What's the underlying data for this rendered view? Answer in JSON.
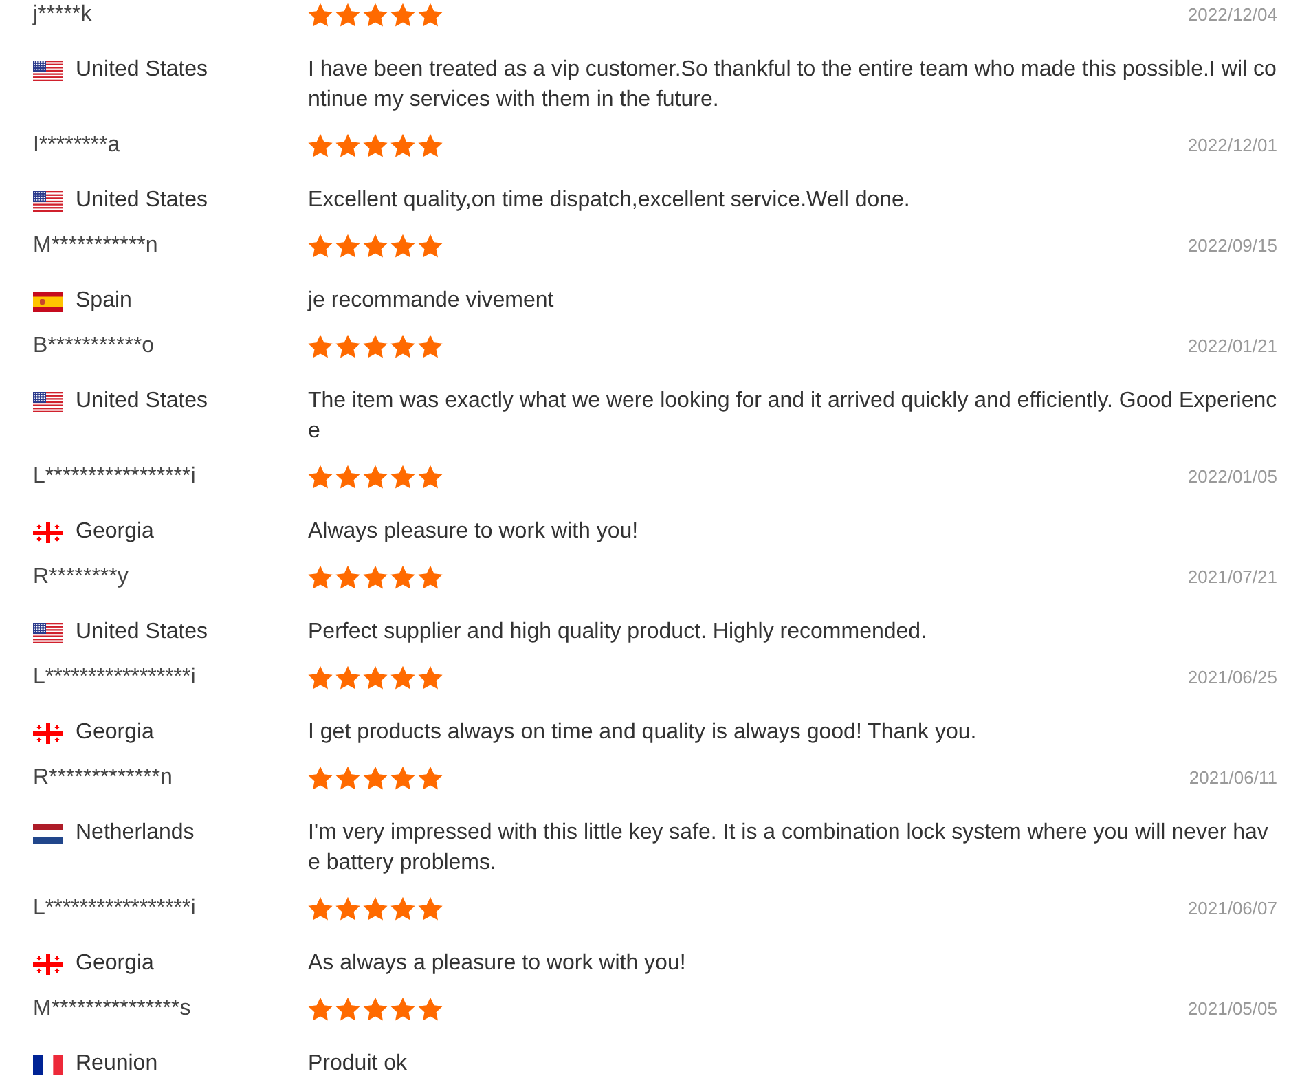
{
  "reviews": [
    {
      "name": "j*****k",
      "stars": 5,
      "date": "2022/12/04",
      "flag": {
        "kind": "us"
      },
      "country": "United States",
      "comment": "I have been treated as a vip customer.So thankful to the entire team who made this possible.I wil continue my services with them in the future."
    },
    {
      "name": "I********a",
      "stars": 5,
      "date": "2022/12/01",
      "flag": {
        "kind": "us"
      },
      "country": "United States",
      "comment": "Excellent quality,on time dispatch,excellent service.Well done."
    },
    {
      "name": "M***********n",
      "stars": 5,
      "date": "2022/09/15",
      "flag": {
        "kind": "es"
      },
      "country": "Spain",
      "comment": "je recommande vivement"
    },
    {
      "name": "B***********o",
      "stars": 5,
      "date": "2022/01/21",
      "flag": {
        "kind": "us"
      },
      "country": "United States",
      "comment": "The item was exactly what we were looking for and it arrived quickly and efficiently. Good Experience"
    },
    {
      "name": "L*****************i",
      "stars": 5,
      "date": "2022/01/05",
      "flag": {
        "kind": "ge"
      },
      "country": "Georgia",
      "comment": "Always pleasure to work with you!"
    },
    {
      "name": "R********y",
      "stars": 5,
      "date": "2021/07/21",
      "flag": {
        "kind": "us"
      },
      "country": "United States",
      "comment": "Perfect supplier and high quality product. Highly recommended."
    },
    {
      "name": "L*****************i",
      "stars": 5,
      "date": "2021/06/25",
      "flag": {
        "kind": "ge"
      },
      "country": "Georgia",
      "comment": "I get products always on time and quality is always good! Thank you."
    },
    {
      "name": "R*************n",
      "stars": 5,
      "date": "2021/06/11",
      "flag": {
        "kind": "nl"
      },
      "country": "Netherlands",
      "comment": "I'm very impressed with this little key safe. It is a combination lock system where you will never have battery problems."
    },
    {
      "name": "L*****************i",
      "stars": 5,
      "date": "2021/06/07",
      "flag": {
        "kind": "ge"
      },
      "country": "Georgia",
      "comment": "As always a pleasure to work with you!"
    },
    {
      "name": "M***************s",
      "stars": 5,
      "date": "2021/05/05",
      "flag": {
        "kind": "fr"
      },
      "country": "Reunion",
      "comment": "Produit ok"
    }
  ]
}
